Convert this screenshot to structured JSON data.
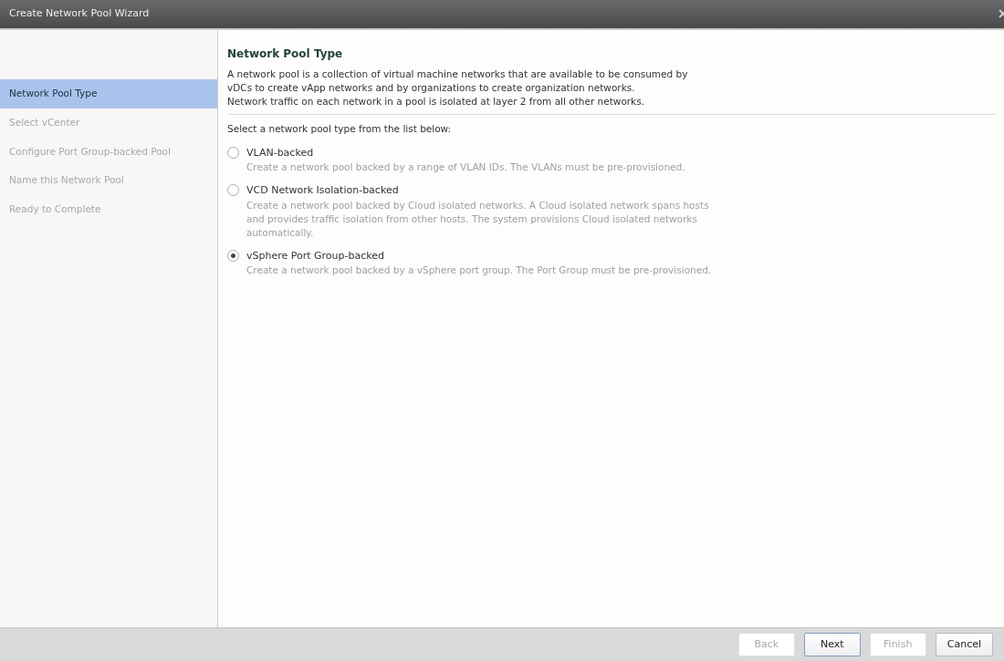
{
  "window": {
    "title": "Create Network Pool Wizard"
  },
  "steps": [
    {
      "label": "Network Pool Type",
      "selected": true,
      "disabled": false
    },
    {
      "label": "Select vCenter",
      "selected": false,
      "disabled": true
    },
    {
      "label": "Configure Port Group-backed Pool",
      "selected": false,
      "disabled": true
    },
    {
      "label": "Name this Network Pool",
      "selected": false,
      "disabled": true
    },
    {
      "label": "Ready to Complete",
      "selected": false,
      "disabled": true
    }
  ],
  "page": {
    "heading": "Network Pool Type",
    "description": [
      "A network pool is a collection of virtual machine networks that are available to be consumed by",
      "vDCs to create vApp networks and by organizations to create organization networks.",
      "Network traffic on each network in a pool is isolated at layer 2 from all other networks."
    ],
    "prompt": "Select a network pool type from the list below:",
    "options": [
      {
        "label": "VLAN-backed",
        "selected": false,
        "description": [
          "Create a network pool backed by a range of VLAN IDs. The VLANs must be pre-provisioned."
        ]
      },
      {
        "label": "VCD Network Isolation-backed",
        "selected": false,
        "description": [
          "Create a network pool backed by Cloud isolated networks. A Cloud isolated network spans hosts",
          "and provides traffic isolation from other hosts. The system provisions Cloud isolated networks",
          "automatically."
        ]
      },
      {
        "label": "vSphere Port Group-backed",
        "selected": true,
        "description": [
          "Create a network pool backed by a vSphere port group. The Port Group must be pre-provisioned."
        ]
      }
    ]
  },
  "buttons": [
    {
      "label": "Back",
      "disabled": true,
      "default": false
    },
    {
      "label": "Next",
      "disabled": false,
      "default": true
    },
    {
      "label": "Finish",
      "disabled": true,
      "default": false
    },
    {
      "label": "Cancel",
      "disabled": false,
      "default": false
    }
  ]
}
